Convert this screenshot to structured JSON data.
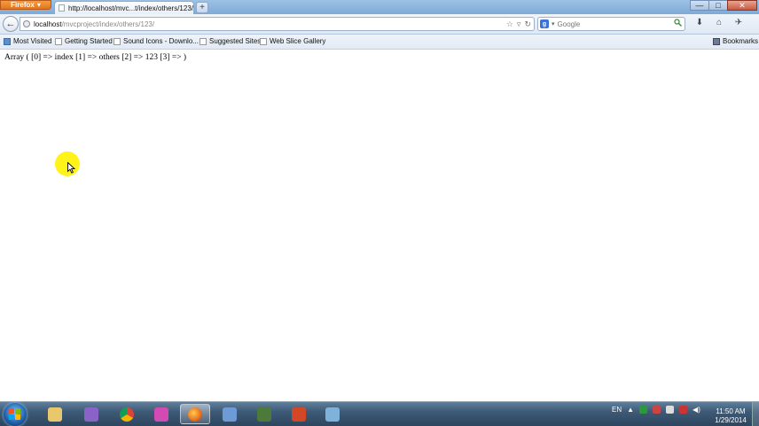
{
  "window": {
    "app_button_label": "Firefox",
    "tab_title": "http://localhost/mvc...t/index/others/123/",
    "new_tab_label": "+",
    "controls": {
      "minimize": "—",
      "maximize": "□",
      "close": "✕"
    }
  },
  "navbar": {
    "back_icon": "←",
    "url_host": "localhost",
    "url_path": "/mvcproject/index/others/123/",
    "bookmark_star": "☆",
    "history_dropdown": "▿",
    "reload_icon": "↻",
    "search_engine": "g",
    "search_engine_dropdown": "▾",
    "search_placeholder": "Google",
    "search_go": "🔍",
    "tools": {
      "downloads": "⬇",
      "home": "⌂",
      "extension": "✈"
    }
  },
  "bookmarks": {
    "items": [
      {
        "label": "Most Visited"
      },
      {
        "label": "Getting Started"
      },
      {
        "label": "Sound Icons - Downlo..."
      },
      {
        "label": "Suggested Sites"
      },
      {
        "label": "Web Slice Gallery"
      }
    ],
    "bookmarks_menu_label": "Bookmarks"
  },
  "content": {
    "array_output": "Array ( [0] => index [1] => others [2] => 123 [3] => )"
  },
  "taskbar": {
    "apps": [
      {
        "icon": "explorer-icon",
        "color": "#e8c86a"
      },
      {
        "icon": "visual-studio-icon",
        "color": "#8a63c9"
      },
      {
        "icon": "chrome-icon",
        "color": "#3aa757"
      },
      {
        "icon": "app-pink-icon",
        "color": "#d24bb5"
      },
      {
        "icon": "firefox-icon",
        "color": "#e96d1e",
        "active": true
      },
      {
        "icon": "virtualbox-icon",
        "color": "#6e9bd6"
      },
      {
        "icon": "media-icon",
        "color": "#4d7a3a"
      },
      {
        "icon": "powerpoint-icon",
        "color": "#d24726"
      },
      {
        "icon": "notepad-icon",
        "color": "#7fb2d9"
      }
    ],
    "language": "EN",
    "clock_time": "11:50 AM",
    "clock_date": "1/29/2014"
  }
}
